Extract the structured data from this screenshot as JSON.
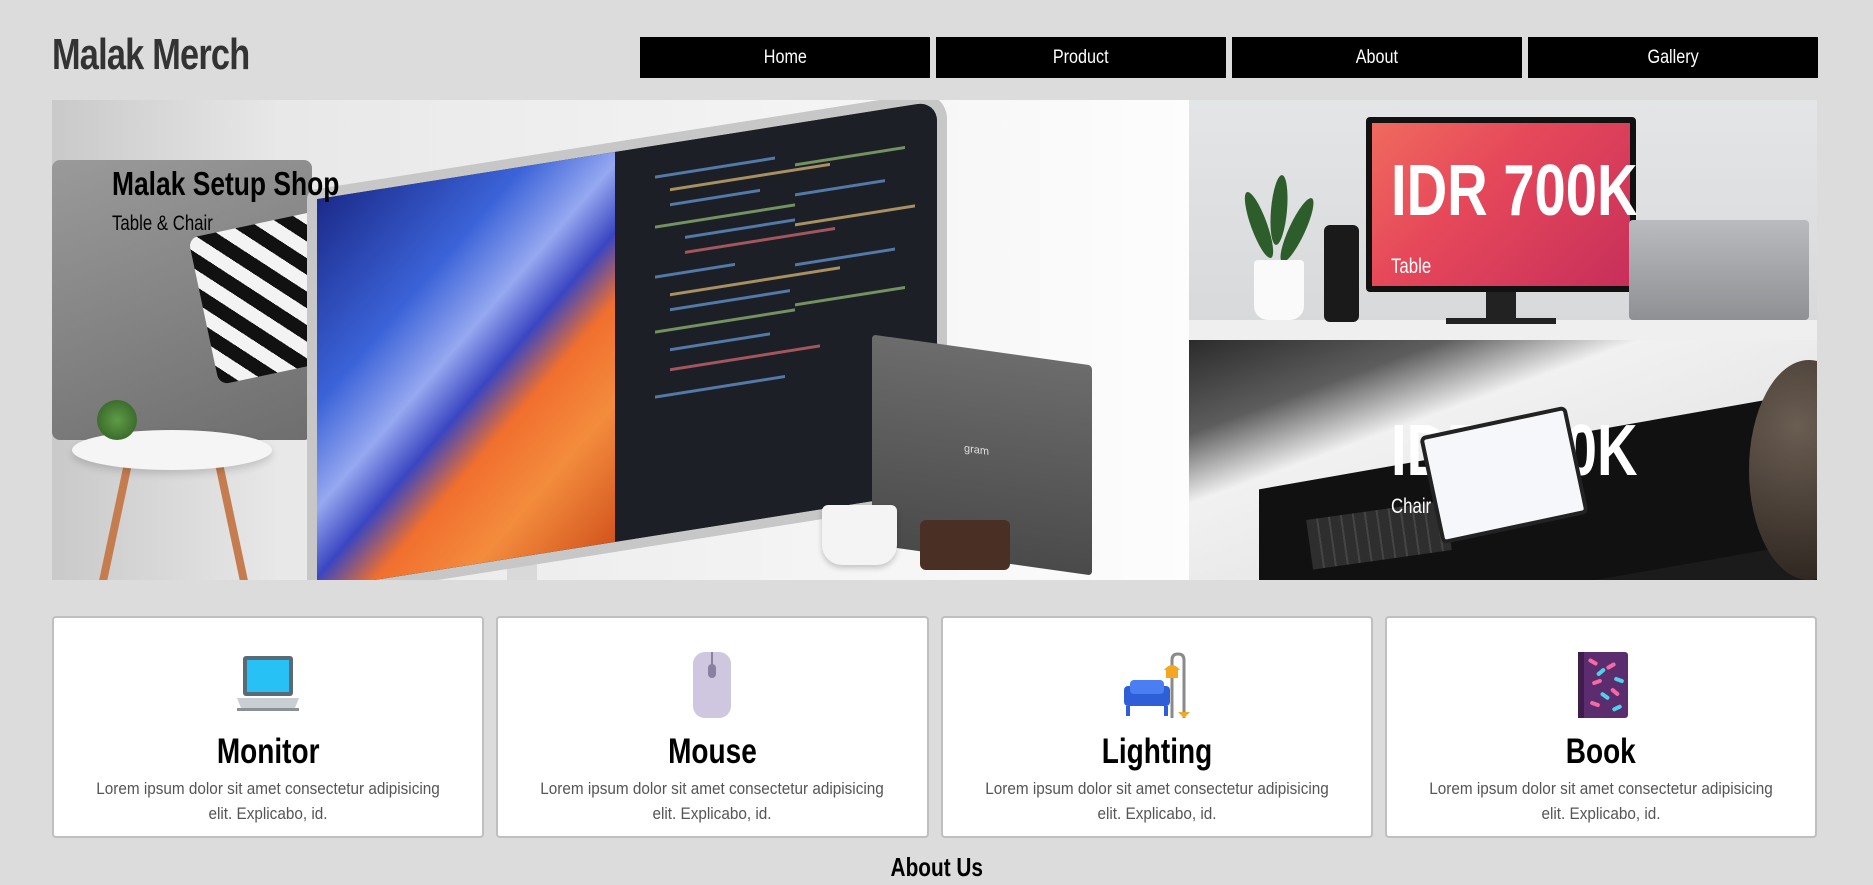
{
  "header": {
    "brand": "Malak Merch",
    "nav": [
      {
        "label": "Home"
      },
      {
        "label": "Product"
      },
      {
        "label": "About"
      },
      {
        "label": "Gallery"
      }
    ]
  },
  "hero": {
    "title": "Malak Setup Shop",
    "subtitle": "Table & Chair",
    "laptop_label": "gram",
    "cards": [
      {
        "price": "IDR 700K",
        "label": "Table"
      },
      {
        "price": "IDR 100K",
        "label": "Chair"
      }
    ]
  },
  "features": [
    {
      "icon": "laptop-icon",
      "title": "Monitor",
      "text": "Lorem ipsum dolor sit amet consectetur adipisicing elit. Explicabo, id."
    },
    {
      "icon": "mouse-icon",
      "title": "Mouse",
      "text": "Lorem ipsum dolor sit amet consectetur adipisicing elit. Explicabo, id."
    },
    {
      "icon": "couch-lamp-icon",
      "title": "Lighting",
      "text": "Lorem ipsum dolor sit amet consectetur adipisicing elit. Explicabo, id."
    },
    {
      "icon": "book-icon",
      "title": "Book",
      "text": "Lorem ipsum dolor sit amet consectetur adipisicing elit. Explicabo, id."
    }
  ],
  "about": {
    "title": "About Us"
  }
}
